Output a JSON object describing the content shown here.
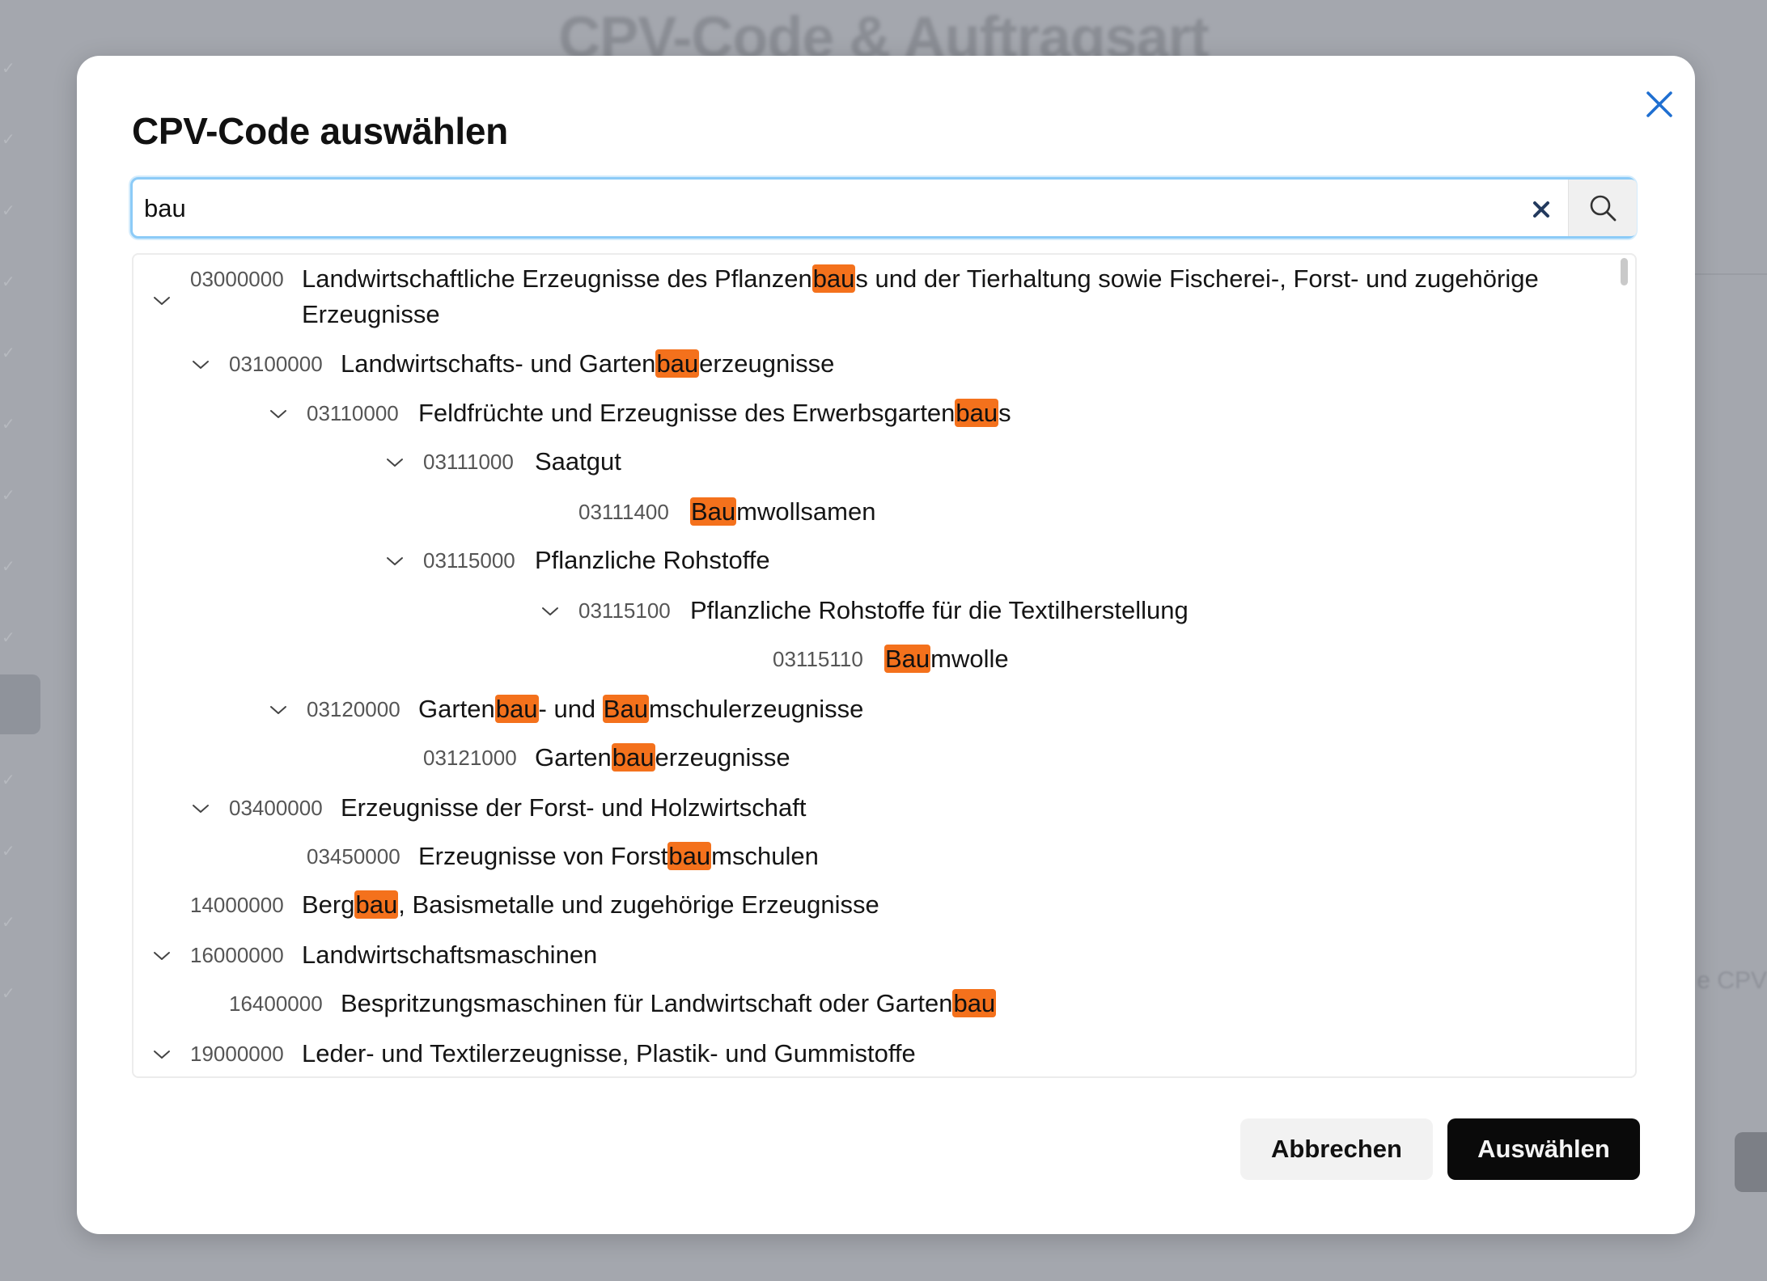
{
  "background": {
    "title": "CPV-Code & Auftragsart",
    "right_text": "e CPV"
  },
  "dialog": {
    "title": "CPV-Code auswählen",
    "close_icon": "close-icon",
    "colors": {
      "highlight": "#f4711c",
      "focus_border": "#8ccbf7",
      "close_icon": "#1f6fd1",
      "primary_button": "#0a0a0a"
    }
  },
  "search": {
    "value": "bau",
    "clear_icon": "clear-icon",
    "search_icon": "search-icon"
  },
  "tree": {
    "items": [
      {
        "code": "03000000",
        "expanded": true,
        "level": 0,
        "parts": [
          "Landwirtschaftliche Erzeugnisse des Pflanzen",
          "bau",
          "s und der Tierhaltung sowie Fischerei-, Forst- und zugehörige Erzeugnisse"
        ]
      },
      {
        "code": "03100000",
        "expanded": true,
        "level": 1,
        "parts": [
          "Landwirtschafts- und Garten",
          "bau",
          "erzeugnisse"
        ]
      },
      {
        "code": "03110000",
        "expanded": true,
        "level": 2,
        "parts": [
          "Feldfrüchte und Erzeugnisse des Erwerbsgarten",
          "bau",
          "s"
        ]
      },
      {
        "code": "03111000",
        "expanded": true,
        "level": 3,
        "parts": [
          "Saatgut"
        ]
      },
      {
        "code": "03111400",
        "expanded": null,
        "level": 4,
        "parts": [
          "",
          "Bau",
          "mwollsamen"
        ]
      },
      {
        "code": "03115000",
        "expanded": true,
        "level": 3,
        "parts": [
          "Pflanzliche Rohstoffe"
        ]
      },
      {
        "code": "03115100",
        "expanded": true,
        "level": 4,
        "parts": [
          "Pflanzliche Rohstoffe für die Textilherstellung"
        ]
      },
      {
        "code": "03115110",
        "expanded": null,
        "level": 5,
        "parts": [
          "",
          "Bau",
          "mwolle"
        ]
      },
      {
        "code": "03120000",
        "expanded": true,
        "level": 2,
        "parts": [
          "Garten",
          "bau",
          "- und ",
          "Bau",
          "mschulerzeugnisse"
        ]
      },
      {
        "code": "03121000",
        "expanded": null,
        "level": 3,
        "parts": [
          "Garten",
          "bau",
          "erzeugnisse"
        ]
      },
      {
        "code": "03400000",
        "expanded": true,
        "level": 1,
        "parts": [
          "Erzeugnisse der Forst- und Holzwirtschaft"
        ]
      },
      {
        "code": "03450000",
        "expanded": null,
        "level": 2,
        "parts": [
          "Erzeugnisse von Forst",
          "bau",
          "mschulen"
        ]
      },
      {
        "code": "14000000",
        "expanded": null,
        "level": 0,
        "parts": [
          "Berg",
          "bau",
          ", Basismetalle und zugehörige Erzeugnisse"
        ]
      },
      {
        "code": "16000000",
        "expanded": true,
        "level": 0,
        "parts": [
          "Landwirtschaftsmaschinen"
        ]
      },
      {
        "code": "16400000",
        "expanded": null,
        "level": 1,
        "parts": [
          "Bespritzungsmaschinen für Landwirtschaft oder Garten",
          "bau"
        ]
      },
      {
        "code": "19000000",
        "expanded": true,
        "level": 0,
        "parts": [
          "Leder- und Textilerzeugnisse, Plastik- und Gummistoffe"
        ]
      }
    ]
  },
  "footer": {
    "cancel_label": "Abbrechen",
    "select_label": "Auswählen"
  }
}
